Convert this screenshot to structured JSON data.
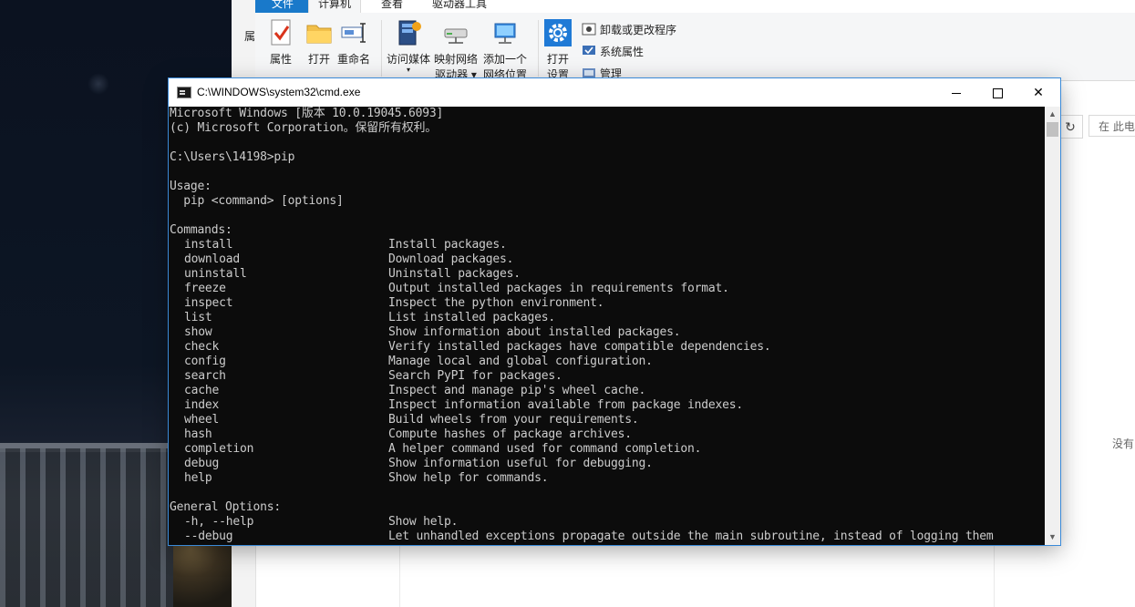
{
  "explorer": {
    "tabs": {
      "file": "文件",
      "computer": "计算机",
      "view": "查看",
      "driver_tools": "驱动器工具"
    },
    "left_strip_label": "属",
    "ribbon": {
      "properties": "属性",
      "open": "打开",
      "rename": "重命名",
      "access_media": "访问媒体",
      "map_network": "映射网络",
      "map_network_2": "驱动器 ▾",
      "add_network": "添加一个",
      "add_network_2": "网络位置",
      "open_settings": "打开",
      "open_settings_2": "设置",
      "uninstall": "卸载或更改程序",
      "system_properties": "系统属性",
      "manage": "管理"
    },
    "search_placeholder": "在 此电",
    "empty_text": "没有"
  },
  "cmd": {
    "title": "C:\\WINDOWS\\system32\\cmd.exe",
    "lines": [
      {
        "text": "Microsoft Windows [版本 10.0.19045.6093]"
      },
      {
        "text": "(c) Microsoft Corporation。保留所有权利。"
      },
      {
        "text": ""
      },
      {
        "text": "C:\\Users\\14198>pip"
      },
      {
        "text": ""
      },
      {
        "text": "Usage:"
      },
      {
        "text": "  pip <command> [options]"
      },
      {
        "text": ""
      },
      {
        "text": "Commands:"
      }
    ],
    "commands": [
      {
        "name": "install",
        "desc": "Install packages."
      },
      {
        "name": "download",
        "desc": "Download packages."
      },
      {
        "name": "uninstall",
        "desc": "Uninstall packages."
      },
      {
        "name": "freeze",
        "desc": "Output installed packages in requirements format."
      },
      {
        "name": "inspect",
        "desc": "Inspect the python environment."
      },
      {
        "name": "list",
        "desc": "List installed packages."
      },
      {
        "name": "show",
        "desc": "Show information about installed packages."
      },
      {
        "name": "check",
        "desc": "Verify installed packages have compatible dependencies."
      },
      {
        "name": "config",
        "desc": "Manage local and global configuration."
      },
      {
        "name": "search",
        "desc": "Search PyPI for packages."
      },
      {
        "name": "cache",
        "desc": "Inspect and manage pip's wheel cache."
      },
      {
        "name": "index",
        "desc": "Inspect information available from package indexes."
      },
      {
        "name": "wheel",
        "desc": "Build wheels from your requirements."
      },
      {
        "name": "hash",
        "desc": "Compute hashes of package archives."
      },
      {
        "name": "completion",
        "desc": "A helper command used for command completion."
      },
      {
        "name": "debug",
        "desc": "Show information useful for debugging."
      },
      {
        "name": "help",
        "desc": "Show help for commands."
      }
    ],
    "general_header": "General Options:",
    "options": [
      {
        "name": "-h, --help",
        "desc": "Show help."
      },
      {
        "name": "--debug",
        "desc": "Let unhandled exceptions propagate outside the main subroutine, instead of logging them"
      }
    ]
  },
  "colors": {
    "console_bg": "#0c0c0c",
    "console_fg": "#cccccc",
    "accent": "#1979ca"
  }
}
